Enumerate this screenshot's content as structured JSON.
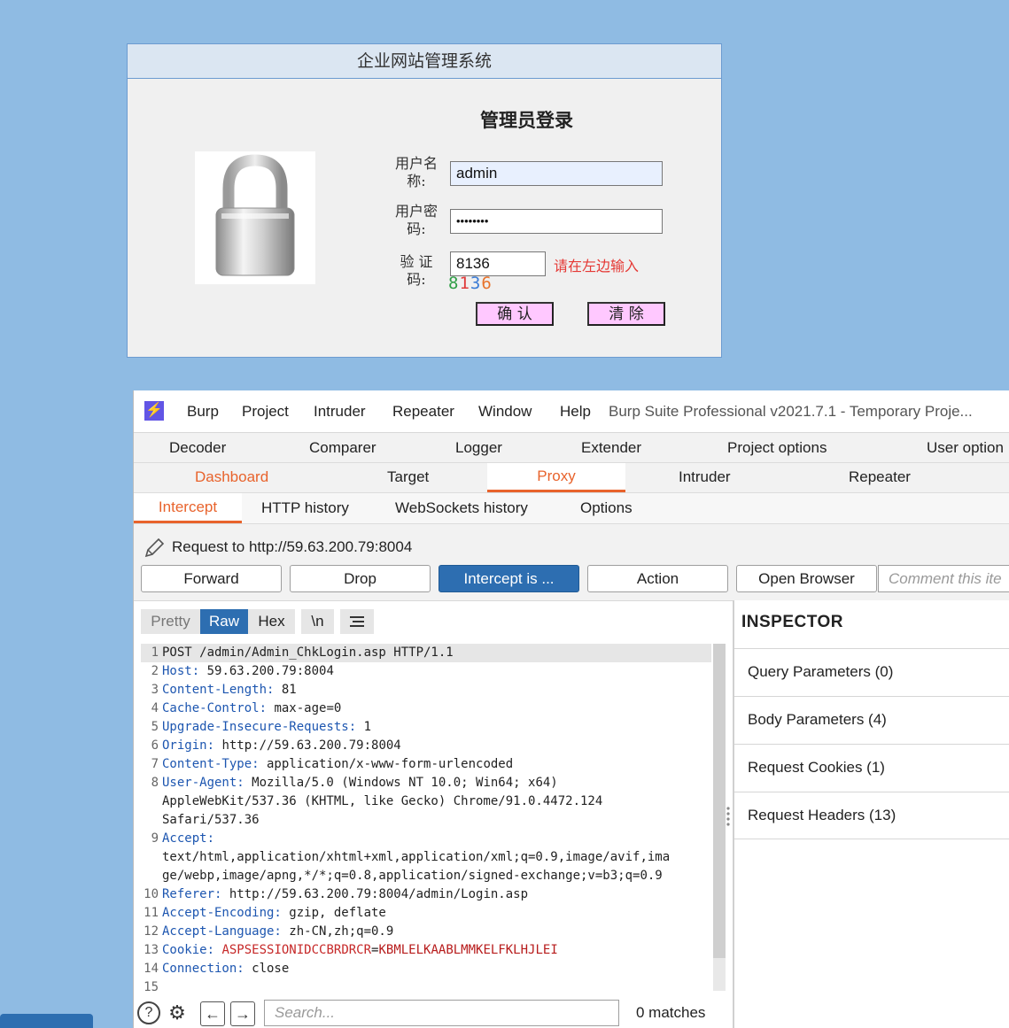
{
  "login": {
    "window_title": "企业网站管理系统",
    "heading": "管理员登录",
    "username_label": "用户名称:",
    "username_label_l1": "用户名",
    "username_label_l2": "称:",
    "username_value": "admin",
    "password_label_l1": "用户密",
    "password_label_l2": "码:",
    "password_masked": "••••••••",
    "captcha_label_l1": "验 证",
    "captcha_label_l2": "码:",
    "captcha_value": "8136",
    "captcha_hint": "请在左边输入",
    "captcha_chars": [
      "8",
      "1",
      "3",
      "6"
    ],
    "captcha_colors": [
      "#2e9e45",
      "#e03b3b",
      "#3a7bd5",
      "#e8732c"
    ],
    "confirm_button": "确 认",
    "clear_button": "清 除"
  },
  "burp": {
    "logo_glyph": "⚡",
    "menu": [
      "Burp",
      "Project",
      "Intruder",
      "Repeater",
      "Window",
      "Help"
    ],
    "window_title": "Burp Suite Professional v2021.7.1 - Temporary Proje...",
    "tabs_row1": [
      "Decoder",
      "Comparer",
      "Logger",
      "Extender",
      "Project options",
      "User option"
    ],
    "tabs_row2": [
      "Dashboard",
      "Target",
      "Proxy",
      "Intruder",
      "Repeater"
    ],
    "active_tab": "Proxy",
    "subtabs": [
      "Intercept",
      "HTTP history",
      "WebSockets history",
      "Options"
    ],
    "active_subtab": "Intercept",
    "request_to": "Request to http://59.63.200.79:8004",
    "buttons": {
      "forward": "Forward",
      "drop": "Drop",
      "intercept": "Intercept is ...",
      "action": "Action",
      "open_browser": "Open Browser"
    },
    "comment_placeholder": "Comment this ite",
    "view_tabs": [
      "Pretty",
      "Raw",
      "Hex",
      "\\n"
    ],
    "active_view_tab": "Raw",
    "request_lines": [
      {
        "n": "1",
        "key": "",
        "val": "POST /admin/Admin_ChkLogin.asp HTTP/1.1"
      },
      {
        "n": "2",
        "key": "Host:",
        "val": " 59.63.200.79:8004"
      },
      {
        "n": "3",
        "key": "Content-Length:",
        "val": " 81"
      },
      {
        "n": "4",
        "key": "Cache-Control:",
        "val": " max-age=0"
      },
      {
        "n": "5",
        "key": "Upgrade-Insecure-Requests:",
        "val": " 1"
      },
      {
        "n": "6",
        "key": "Origin:",
        "val": " http://59.63.200.79:8004"
      },
      {
        "n": "7",
        "key": "Content-Type:",
        "val": " application/x-www-form-urlencoded"
      },
      {
        "n": "8",
        "key": "User-Agent:",
        "val": " Mozilla/5.0 (Windows NT 10.0; Win64; x64)"
      },
      {
        "n": "",
        "key": "",
        "val": "AppleWebKit/537.36 (KHTML, like Gecko) Chrome/91.0.4472.124"
      },
      {
        "n": "",
        "key": "",
        "val": "Safari/537.36"
      },
      {
        "n": "9",
        "key": "Accept:",
        "val": ""
      },
      {
        "n": "",
        "key": "",
        "val": "text/html,application/xhtml+xml,application/xml;q=0.9,image/avif,ima"
      },
      {
        "n": "",
        "key": "",
        "val": "ge/webp,image/apng,*/*;q=0.8,application/signed-exchange;v=b3;q=0.9"
      },
      {
        "n": "10",
        "key": "Referer:",
        "val": " http://59.63.200.79:8004/admin/Login.asp"
      },
      {
        "n": "11",
        "key": "Accept-Encoding:",
        "val": " gzip, deflate"
      },
      {
        "n": "12",
        "key": "Accept-Language:",
        "val": " zh-CN,zh;q=0.9"
      },
      {
        "n": "13",
        "key": "Cookie:",
        "val": ""
      },
      {
        "n": "14",
        "key": "Connection:",
        "val": " close"
      },
      {
        "n": "15",
        "key": "",
        "val": ""
      }
    ],
    "cookie_name": "ASPSESSIONIDCCBRDRCR",
    "cookie_eq": "=",
    "cookie_value": "KBMLELKAABLMMKELFKLHJLEI",
    "search_placeholder": "Search...",
    "matches": "0 matches",
    "inspector": {
      "title": "INSPECTOR",
      "rows": [
        "Query Parameters (0)",
        "Body Parameters (4)",
        "Request Cookies (1)",
        "Request Headers (13)"
      ]
    }
  }
}
